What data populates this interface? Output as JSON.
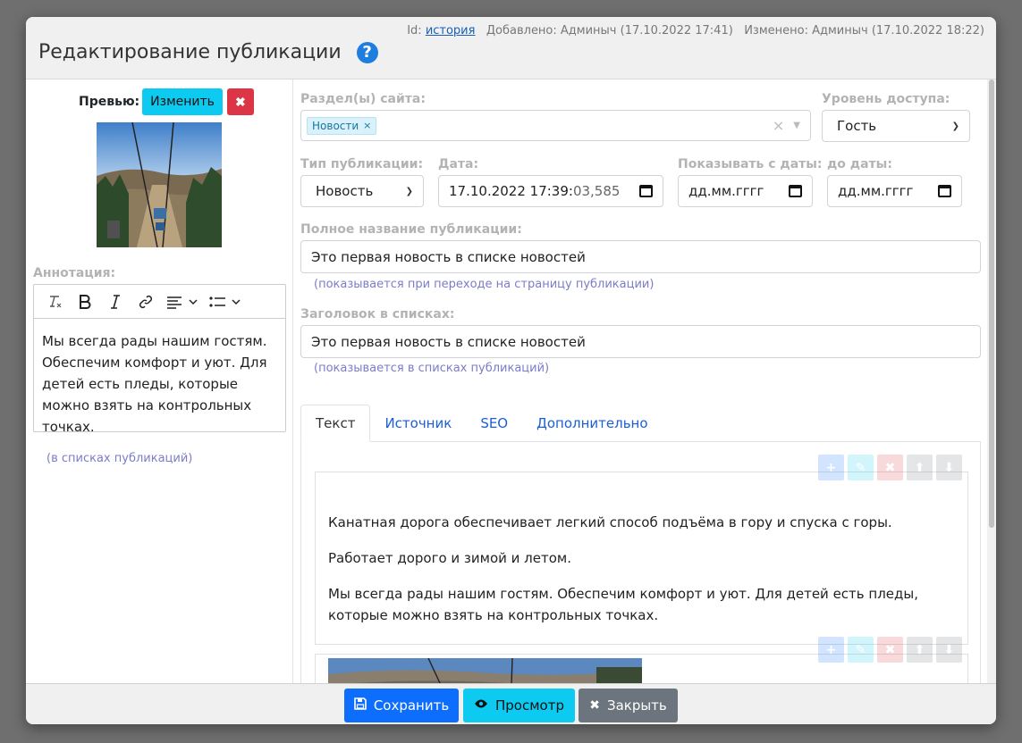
{
  "header": {
    "meta_id_label": "Id:",
    "meta_id_link": "история",
    "meta_added": "Добавлено: Админыч (17.10.2022 17:41)",
    "meta_changed": "Изменено: Админыч (17.10.2022 18:22)",
    "title": "Редактирование публикации",
    "help_icon": "question-circle-icon",
    "help_glyph": "?"
  },
  "preview": {
    "label": "Превью:",
    "change_label": "Изменить",
    "delete_glyph": "✖"
  },
  "annotation": {
    "label": "Аннотация:",
    "text": "Мы всегда рады нашим гостям. Обеспечим комфорт и уют. Для детей есть пледы, которые можно взять на контрольных точках.",
    "hint": "(в списках публикаций)",
    "toolbar": [
      "clear-format-icon",
      "bold-icon",
      "italic-icon",
      "link-icon",
      "align-icon",
      "list-icon"
    ]
  },
  "form": {
    "sections_label": "Раздел(ы) сайта:",
    "sections_tag": "Новости",
    "tag_remove_glyph": "×",
    "clear_glyph": "×",
    "access_label": "Уровень доступа:",
    "access_value": "Гость",
    "type_label": "Тип публикации:",
    "type_value": "Новость",
    "date_label": "Дата:",
    "date_value_main": "17.10.2022 17:39:",
    "date_value_muted": "03,585",
    "show_from_label": "Показывать с даты:",
    "show_from_placeholder": "дд.мм.гггг",
    "show_to_label": "до даты:",
    "show_to_placeholder": "дд.мм.гггг",
    "full_title_label": "Полное название публикации:",
    "full_title_value": "Это первая новость в списке новостей",
    "full_title_hint": "(показывается при переходе на страницу публикации)",
    "list_title_label": "Заголовок в списках:",
    "list_title_value": "Это первая новость в списке новостей",
    "list_title_hint": "(показывается в списках публикаций)"
  },
  "tabs": [
    {
      "label": "Текст",
      "active": true
    },
    {
      "label": "Источник",
      "active": false
    },
    {
      "label": "SEO",
      "active": false
    },
    {
      "label": "Дополнительно",
      "active": false
    }
  ],
  "content": {
    "paragraphs": [
      "Канатная дорога обеспечивает легкий способ подъёма в гору и спуска с горы.",
      "Работает дорого и зимой и летом.",
      "Мы всегда рады нашим гостям. Обеспечим комфорт и уют. Для детей есть пледы, которые можно взять на контрольных точках."
    ],
    "block_tools": [
      {
        "name": "add-icon",
        "glyph": "+",
        "color": "#0d6efd"
      },
      {
        "name": "edit-icon",
        "glyph": "✎",
        "color": "#0dcaf0"
      },
      {
        "name": "delete-icon",
        "glyph": "✖",
        "color": "#dc3545"
      },
      {
        "name": "move-up-icon",
        "glyph": "⬆",
        "color": "#6c757d"
      },
      {
        "name": "move-down-icon",
        "glyph": "⬇",
        "color": "#6c757d"
      }
    ]
  },
  "footer": {
    "save_label": "Сохранить",
    "preview_label": "Просмотр",
    "close_label": "Закрыть"
  },
  "colors": {
    "primary": "#0d6efd",
    "info": "#0dcaf0",
    "danger": "#dc3545",
    "secondary": "#6c757d",
    "hint": "#7c7cc8"
  }
}
